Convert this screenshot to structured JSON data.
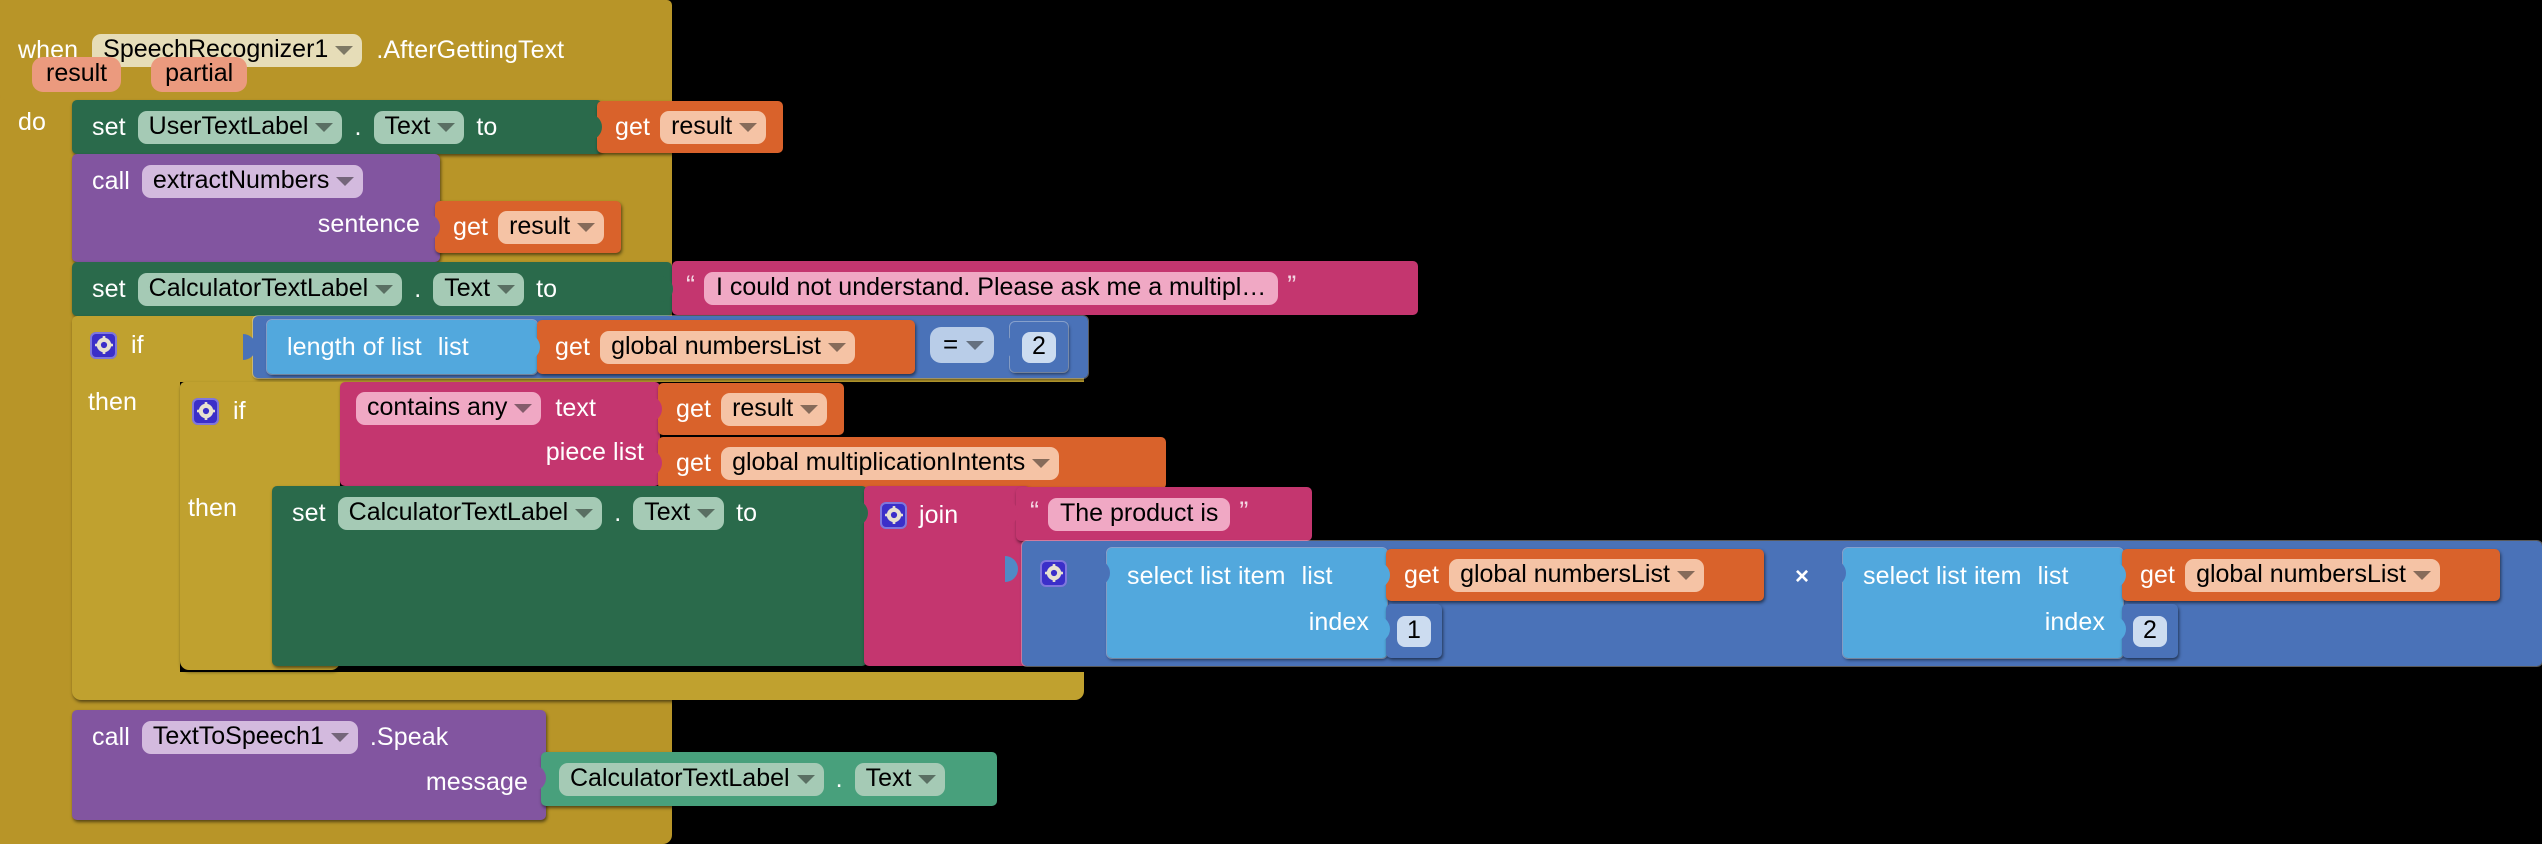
{
  "workspace": {
    "background_color": "#000000"
  },
  "event_block": {
    "when_label": "when",
    "component": "SpeechRecognizer1",
    "event": ".AfterGettingText",
    "params": [
      "result",
      "partial"
    ],
    "do_label": "do",
    "color": "#b89528"
  },
  "statements": {
    "set_user_text": {
      "set_label": "set",
      "component": "UserTextLabel",
      "dot": ".",
      "property": "Text",
      "to_label": "to",
      "value": {
        "get_label": "get",
        "variable": "result"
      },
      "color": "#2a6a4b"
    },
    "call_extract": {
      "call_label": "call",
      "procedure": "extractNumbers",
      "arg_label": "sentence",
      "arg_value": {
        "get_label": "get",
        "variable": "result"
      },
      "color": "#8255a0"
    },
    "set_calc_default": {
      "set_label": "set",
      "component": "CalculatorTextLabel",
      "dot": ".",
      "property": "Text",
      "to_label": "to",
      "text_value": "I could not understand.  Please ask me a multipl…",
      "open_quote": "“",
      "close_quote": "”",
      "color": "#2a6a4b"
    },
    "outer_if": {
      "if_label": "if",
      "then_label": "then",
      "condition": {
        "length_of_list_label": "length of list",
        "list_label": "list",
        "list_value": {
          "get_label": "get",
          "variable": "global numbersList"
        },
        "operator": "=",
        "compare_value": "2"
      },
      "color": "#c0a12f"
    },
    "inner_if": {
      "if_label": "if",
      "then_label": "then",
      "condition": {
        "mode": "contains any",
        "text_label": "text",
        "text_value": {
          "get_label": "get",
          "variable": "result"
        },
        "piece_list_label": "piece list",
        "piece_list_value": {
          "get_label": "get",
          "variable": "global multiplicationIntents"
        }
      },
      "color": "#c0a12f"
    },
    "set_calc_product": {
      "set_label": "set",
      "component": "CalculatorTextLabel",
      "dot": ".",
      "property": "Text",
      "to_label": "to",
      "join": {
        "join_label": "join",
        "string_item": "The product is",
        "open_quote": "“",
        "close_quote": "”",
        "multiply": {
          "operator_symbol": "×",
          "left": {
            "select_label": "select list item",
            "list_label": "list",
            "list_value": {
              "get_label": "get",
              "variable": "global numbersList"
            },
            "index_label": "index",
            "index_value": "1"
          },
          "right": {
            "select_label": "select list item",
            "list_label": "list",
            "list_value": {
              "get_label": "get",
              "variable": "global numbersList"
            },
            "index_label": "index",
            "index_value": "2"
          }
        }
      },
      "color": "#2a6a4b"
    },
    "call_speak": {
      "call_label": "call",
      "component": "TextToSpeech1",
      "method": ".Speak",
      "arg_label": "message",
      "arg_value": {
        "component": "CalculatorTextLabel",
        "dot": ".",
        "property": "Text"
      },
      "color": "#8255a0"
    }
  },
  "icons": {
    "mutator": "gear-icon",
    "dropdown": "chevron-down-icon"
  }
}
